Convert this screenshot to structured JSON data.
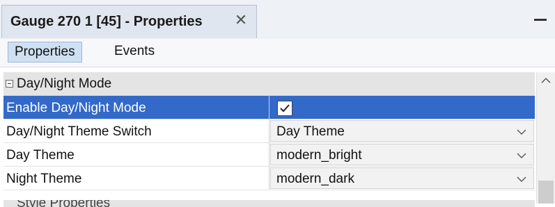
{
  "window": {
    "tab_title": "Gauge 270 1 [45] - Properties",
    "close_glyph": "✕"
  },
  "subtabs": [
    {
      "label": "Properties",
      "active": true
    },
    {
      "label": "Events",
      "active": false
    }
  ],
  "grid": {
    "category": "Day/Night Mode",
    "rows": [
      {
        "name": "Enable Day/Night Mode",
        "type": "checkbox",
        "checked": true,
        "selected": true
      },
      {
        "name": "Day/Night Theme Switch",
        "type": "dropdown",
        "value": "Day Theme"
      },
      {
        "name": "Day Theme",
        "type": "dropdown",
        "value": "modern_bright"
      },
      {
        "name": "Night Theme",
        "type": "dropdown",
        "value": "modern_dark"
      }
    ],
    "next_category_partial": "Style Properties"
  },
  "colors": {
    "selection": "#3369c8",
    "active_subtab": "#cfe0f2",
    "category_bg": "#e4e4e4"
  },
  "icons": [
    "close-icon",
    "minimize-icon",
    "collapse-icon",
    "checkmark-icon",
    "chevron-down-icon",
    "scroll-up-arrow-icon"
  ]
}
